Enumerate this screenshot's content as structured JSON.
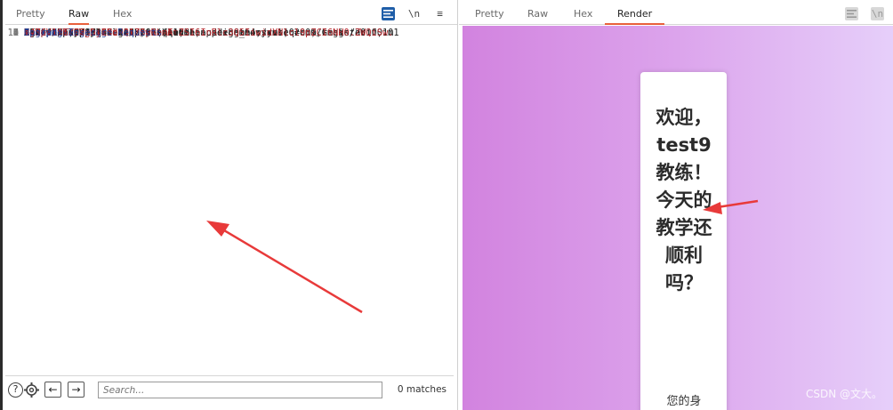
{
  "left_pane": {
    "tabs": [
      "Pretty",
      "Raw",
      "Hex"
    ],
    "active_tab": "Raw",
    "tool_icons": [
      "list-view-icon",
      "newline-toggle-icon",
      "menu-icon"
    ],
    "newline_label": "\\n",
    "menu_label": "≡",
    "lines": [
      {
        "num": "1",
        "header": "",
        "value": "GET / HTTP/1.1"
      },
      {
        "num": "2",
        "header": "Host",
        "value": ": esvp9o536dc4k37t6znqecdle.node.game.sycsec.com"
      },
      {
        "num": "3",
        "header": "User-Agent",
        "value": ": Mozilla/5.0 (X11; Linux x86_64; rv:102.0) Gecko/20100101"
      },
      {
        "num": "",
        "header": "",
        "value": "Firefox/102.0"
      },
      {
        "num": "4",
        "header": "Accept",
        "value": ":"
      },
      {
        "num": "",
        "header": "",
        "value": "text/html,application/xhtml+xml,application/xml;q=0.9,image/avif,im"
      },
      {
        "num": "",
        "header": "",
        "value": "age/webp,*/*;q=0.8"
      },
      {
        "num": "5",
        "header": "Accept-Language",
        "value": ": en-US,en;q=0.5"
      },
      {
        "num": "6",
        "header": "Accept-Encoding",
        "value": ": gzip, deflate"
      },
      {
        "num": "7",
        "header": "Referer",
        "value": ":"
      },
      {
        "num": "",
        "header": "",
        "value": "http://esvp9o536dc4k37t6znqecdle.node.game.sycsec.com/register"
      },
      {
        "num": "8",
        "header": "Connection",
        "value": ": close"
      },
      {
        "num": "9",
        "header": "Cookie",
        "value": ": session="
      },
      {
        "num": "",
        "header": "",
        "value": "eyJpc19hZG1pbiI6dHJ1ZSwibmFtZSI6InRlc3Q5IiwidXNlcl9pZCI6NH0.ZWQiSw.",
        "cookie": true
      },
      {
        "num": "",
        "header": "",
        "value": "V4HCVirTTFWgDyENt-Qtd0pRcmA",
        "cookie": true
      },
      {
        "num": "10",
        "header": "Upgrade-Insecure-Requests",
        "value": ": 1"
      },
      {
        "num": "11",
        "header": "",
        "value": ""
      },
      {
        "num": "12",
        "header": "",
        "value": ""
      }
    ],
    "search": {
      "placeholder": "Search...",
      "matches": "0 matches",
      "help_label": "?",
      "prev_label": "←",
      "next_label": "→"
    }
  },
  "right_pane": {
    "tabs": [
      "Pretty",
      "Raw",
      "Hex",
      "Render"
    ],
    "active_tab": "Render",
    "tool_icons": [
      "list-view-icon",
      "newline-toggle-icon"
    ],
    "render": {
      "title": "欢迎，test9教练！今天的教学还顺利吗？",
      "subtitle": "您的身",
      "watermark": "CSDN @文大。"
    }
  },
  "colors": {
    "active_tab_underline": "#e8603c",
    "header_name": "#1f3b8c",
    "cookie_value": "#b3262b",
    "arrow": "#e83a3a",
    "gradient_start": "#d283df",
    "gradient_end": "#e6cffa"
  }
}
